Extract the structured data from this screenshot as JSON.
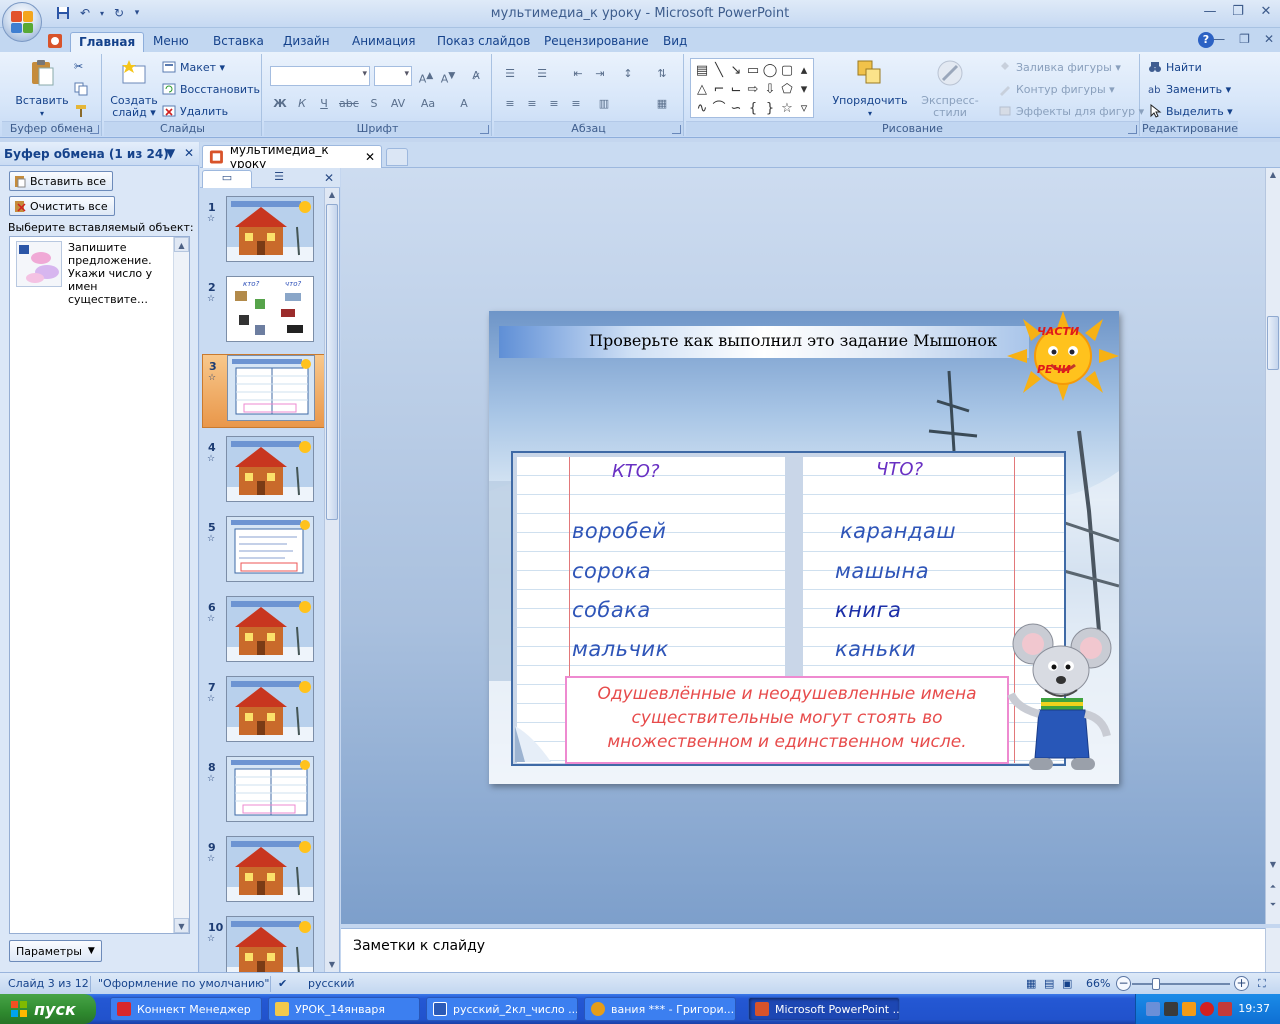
{
  "window": {
    "title": "мультимедиа_к уроку - Microsoft PowerPoint",
    "controls": [
      "—",
      "❐",
      "✕"
    ]
  },
  "tabs": [
    "Главная",
    "Меню",
    "Вставка",
    "Дизайн",
    "Анимация",
    "Показ слайдов",
    "Рецензирование",
    "Вид"
  ],
  "ribbon": {
    "clipboard": {
      "label": "Буфер обмена",
      "paste": "Вставить"
    },
    "slides": {
      "label": "Слайды",
      "new_slide_line1": "Создать",
      "new_slide_line2": "слайд ▾",
      "layout": "Макет ▾",
      "reset": "Восстановить",
      "delete": "Удалить"
    },
    "font": {
      "label": "Шрифт"
    },
    "paragraph": {
      "label": "Абзац"
    },
    "drawing": {
      "label": "Рисование",
      "arrange": "Упорядочить",
      "quick_styles": "Экспресс-стили",
      "fill": "Заливка фигуры ▾",
      "outline": "Контур фигуры ▾",
      "effects": "Эффекты для фигур ▾"
    },
    "editing": {
      "label": "Редактирование",
      "find": "Найти",
      "replace": "Заменить ▾",
      "select": "Выделить ▾"
    }
  },
  "clipboard_pane": {
    "title": "Буфер обмена (1 из 24)",
    "paste_all": "Вставить все",
    "clear_all": "Очистить все",
    "hint": "Выберите вставляемый объект:",
    "items": [
      {
        "text": "Запишите предложение. Укажи число у имен существите…"
      }
    ],
    "options": "Параметры"
  },
  "document_tab": {
    "name": "мультимедиа_к уроку"
  },
  "thumbnails": [
    {
      "num": "1",
      "kind": "house"
    },
    {
      "num": "2",
      "kind": "pictures"
    },
    {
      "num": "3",
      "kind": "table"
    },
    {
      "num": "4",
      "kind": "house"
    },
    {
      "num": "5",
      "kind": "text"
    },
    {
      "num": "6",
      "kind": "house"
    },
    {
      "num": "7",
      "kind": "house"
    },
    {
      "num": "8",
      "kind": "table"
    },
    {
      "num": "9",
      "kind": "house"
    },
    {
      "num": "10",
      "kind": "house"
    }
  ],
  "thumbnail_labels": {
    "kto": "кто?",
    "chto": "что?"
  },
  "selected_slide": 3,
  "slide": {
    "title": "Проверьте как выполнил это задание Мышонок",
    "badge_line1": "ЧАСТИ",
    "badge_line2": "РЕЧИ",
    "col_left": "КТО?",
    "col_right": "ЧТО?",
    "left_words": [
      "воробей",
      "сорока",
      "собака",
      "мальчик"
    ],
    "right_words": [
      "карандаш",
      "машына",
      "книга",
      "каньки"
    ],
    "rule_line1": "Одушевлённые и неодушевленные имена",
    "rule_line2": "существительные могут стоять во",
    "rule_line3": "множественном и  единственном числе."
  },
  "notes": {
    "placeholder": "Заметки к слайду"
  },
  "status": {
    "slide": "Слайд 3 из 12",
    "theme": "\"Оформление по умолчанию\"",
    "language": "русский",
    "zoom": "66%",
    "zoom_fraction": 0.66
  },
  "taskbar": {
    "start": "пуск",
    "buttons": [
      "Коннект Менеджер",
      "УРОК_14января",
      "русский_2кл_число ...",
      "вания *** - Григори...",
      "Microsoft PowerPoint ..."
    ],
    "clock": "19:37"
  },
  "colors": {
    "ribbon_bg": "#d7e6f9",
    "accent": "#15428b",
    "selected_thumb": "#e9974a",
    "taskbar": "#2458d4",
    "word_blue": "#2f55b8",
    "rule_red": "#e74b4b",
    "heading_violet": "#6930c3"
  }
}
